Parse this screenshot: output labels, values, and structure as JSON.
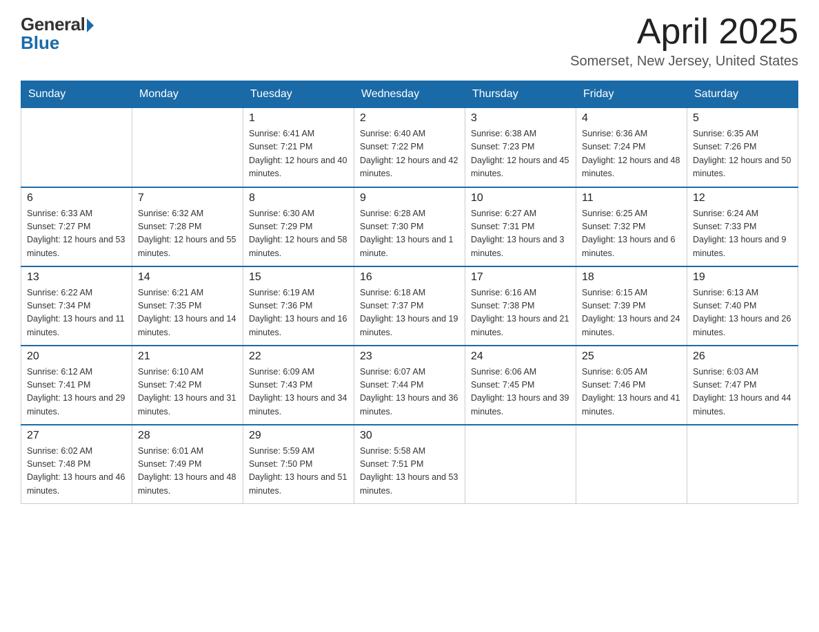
{
  "header": {
    "logo_general": "General",
    "logo_blue": "Blue",
    "month": "April 2025",
    "location": "Somerset, New Jersey, United States"
  },
  "days_of_week": [
    "Sunday",
    "Monday",
    "Tuesday",
    "Wednesday",
    "Thursday",
    "Friday",
    "Saturday"
  ],
  "weeks": [
    [
      {
        "day": "",
        "sunrise": "",
        "sunset": "",
        "daylight": ""
      },
      {
        "day": "",
        "sunrise": "",
        "sunset": "",
        "daylight": ""
      },
      {
        "day": "1",
        "sunrise": "Sunrise: 6:41 AM",
        "sunset": "Sunset: 7:21 PM",
        "daylight": "Daylight: 12 hours and 40 minutes."
      },
      {
        "day": "2",
        "sunrise": "Sunrise: 6:40 AM",
        "sunset": "Sunset: 7:22 PM",
        "daylight": "Daylight: 12 hours and 42 minutes."
      },
      {
        "day": "3",
        "sunrise": "Sunrise: 6:38 AM",
        "sunset": "Sunset: 7:23 PM",
        "daylight": "Daylight: 12 hours and 45 minutes."
      },
      {
        "day": "4",
        "sunrise": "Sunrise: 6:36 AM",
        "sunset": "Sunset: 7:24 PM",
        "daylight": "Daylight: 12 hours and 48 minutes."
      },
      {
        "day": "5",
        "sunrise": "Sunrise: 6:35 AM",
        "sunset": "Sunset: 7:26 PM",
        "daylight": "Daylight: 12 hours and 50 minutes."
      }
    ],
    [
      {
        "day": "6",
        "sunrise": "Sunrise: 6:33 AM",
        "sunset": "Sunset: 7:27 PM",
        "daylight": "Daylight: 12 hours and 53 minutes."
      },
      {
        "day": "7",
        "sunrise": "Sunrise: 6:32 AM",
        "sunset": "Sunset: 7:28 PM",
        "daylight": "Daylight: 12 hours and 55 minutes."
      },
      {
        "day": "8",
        "sunrise": "Sunrise: 6:30 AM",
        "sunset": "Sunset: 7:29 PM",
        "daylight": "Daylight: 12 hours and 58 minutes."
      },
      {
        "day": "9",
        "sunrise": "Sunrise: 6:28 AM",
        "sunset": "Sunset: 7:30 PM",
        "daylight": "Daylight: 13 hours and 1 minute."
      },
      {
        "day": "10",
        "sunrise": "Sunrise: 6:27 AM",
        "sunset": "Sunset: 7:31 PM",
        "daylight": "Daylight: 13 hours and 3 minutes."
      },
      {
        "day": "11",
        "sunrise": "Sunrise: 6:25 AM",
        "sunset": "Sunset: 7:32 PM",
        "daylight": "Daylight: 13 hours and 6 minutes."
      },
      {
        "day": "12",
        "sunrise": "Sunrise: 6:24 AM",
        "sunset": "Sunset: 7:33 PM",
        "daylight": "Daylight: 13 hours and 9 minutes."
      }
    ],
    [
      {
        "day": "13",
        "sunrise": "Sunrise: 6:22 AM",
        "sunset": "Sunset: 7:34 PM",
        "daylight": "Daylight: 13 hours and 11 minutes."
      },
      {
        "day": "14",
        "sunrise": "Sunrise: 6:21 AM",
        "sunset": "Sunset: 7:35 PM",
        "daylight": "Daylight: 13 hours and 14 minutes."
      },
      {
        "day": "15",
        "sunrise": "Sunrise: 6:19 AM",
        "sunset": "Sunset: 7:36 PM",
        "daylight": "Daylight: 13 hours and 16 minutes."
      },
      {
        "day": "16",
        "sunrise": "Sunrise: 6:18 AM",
        "sunset": "Sunset: 7:37 PM",
        "daylight": "Daylight: 13 hours and 19 minutes."
      },
      {
        "day": "17",
        "sunrise": "Sunrise: 6:16 AM",
        "sunset": "Sunset: 7:38 PM",
        "daylight": "Daylight: 13 hours and 21 minutes."
      },
      {
        "day": "18",
        "sunrise": "Sunrise: 6:15 AM",
        "sunset": "Sunset: 7:39 PM",
        "daylight": "Daylight: 13 hours and 24 minutes."
      },
      {
        "day": "19",
        "sunrise": "Sunrise: 6:13 AM",
        "sunset": "Sunset: 7:40 PM",
        "daylight": "Daylight: 13 hours and 26 minutes."
      }
    ],
    [
      {
        "day": "20",
        "sunrise": "Sunrise: 6:12 AM",
        "sunset": "Sunset: 7:41 PM",
        "daylight": "Daylight: 13 hours and 29 minutes."
      },
      {
        "day": "21",
        "sunrise": "Sunrise: 6:10 AM",
        "sunset": "Sunset: 7:42 PM",
        "daylight": "Daylight: 13 hours and 31 minutes."
      },
      {
        "day": "22",
        "sunrise": "Sunrise: 6:09 AM",
        "sunset": "Sunset: 7:43 PM",
        "daylight": "Daylight: 13 hours and 34 minutes."
      },
      {
        "day": "23",
        "sunrise": "Sunrise: 6:07 AM",
        "sunset": "Sunset: 7:44 PM",
        "daylight": "Daylight: 13 hours and 36 minutes."
      },
      {
        "day": "24",
        "sunrise": "Sunrise: 6:06 AM",
        "sunset": "Sunset: 7:45 PM",
        "daylight": "Daylight: 13 hours and 39 minutes."
      },
      {
        "day": "25",
        "sunrise": "Sunrise: 6:05 AM",
        "sunset": "Sunset: 7:46 PM",
        "daylight": "Daylight: 13 hours and 41 minutes."
      },
      {
        "day": "26",
        "sunrise": "Sunrise: 6:03 AM",
        "sunset": "Sunset: 7:47 PM",
        "daylight": "Daylight: 13 hours and 44 minutes."
      }
    ],
    [
      {
        "day": "27",
        "sunrise": "Sunrise: 6:02 AM",
        "sunset": "Sunset: 7:48 PM",
        "daylight": "Daylight: 13 hours and 46 minutes."
      },
      {
        "day": "28",
        "sunrise": "Sunrise: 6:01 AM",
        "sunset": "Sunset: 7:49 PM",
        "daylight": "Daylight: 13 hours and 48 minutes."
      },
      {
        "day": "29",
        "sunrise": "Sunrise: 5:59 AM",
        "sunset": "Sunset: 7:50 PM",
        "daylight": "Daylight: 13 hours and 51 minutes."
      },
      {
        "day": "30",
        "sunrise": "Sunrise: 5:58 AM",
        "sunset": "Sunset: 7:51 PM",
        "daylight": "Daylight: 13 hours and 53 minutes."
      },
      {
        "day": "",
        "sunrise": "",
        "sunset": "",
        "daylight": ""
      },
      {
        "day": "",
        "sunrise": "",
        "sunset": "",
        "daylight": ""
      },
      {
        "day": "",
        "sunrise": "",
        "sunset": "",
        "daylight": ""
      }
    ]
  ]
}
